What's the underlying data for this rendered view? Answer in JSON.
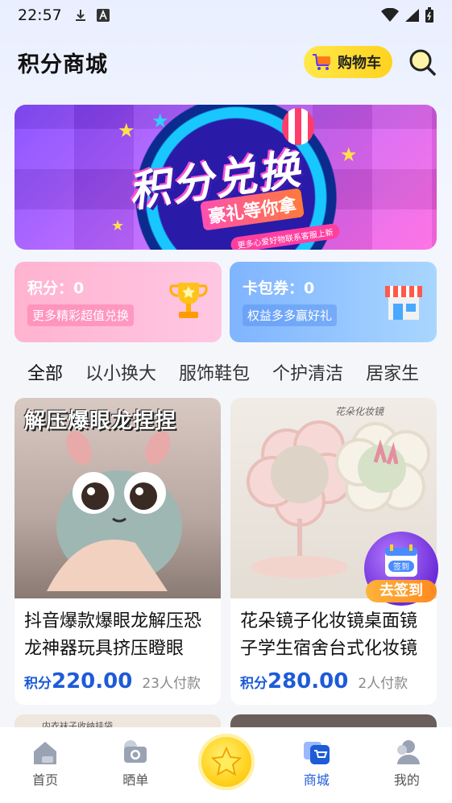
{
  "status_bar": {
    "time": "22:57"
  },
  "header": {
    "title": "积分商城",
    "cart_label": "购物车"
  },
  "banner": {
    "title": "积分兑换",
    "subtitle": "豪礼等你拿",
    "note": "更多心爱好物联系客服上新"
  },
  "cards": {
    "points": {
      "label": "积分：0",
      "sub": "更多精彩超值兑换"
    },
    "coupons": {
      "label": "卡包券：0",
      "sub": "权益多多赢好礼"
    }
  },
  "tabs": [
    {
      "label": "全部",
      "active": true
    },
    {
      "label": "以小换大"
    },
    {
      "label": "服饰鞋包"
    },
    {
      "label": "个护清洁"
    },
    {
      "label": "居家生"
    }
  ],
  "products": [
    {
      "image_caption": "解压爆眼龙捏捏",
      "name": "抖音爆款爆眼龙解压恐龙神器玩具挤压瞪眼",
      "price_label": "积分",
      "price": "220.00",
      "paid": "23人付款"
    },
    {
      "image_caption": "花朵化妆镜",
      "name": "花朵镜子化妆镜桌面镜子学生宿舍台式化妆镜",
      "price_label": "积分",
      "price": "280.00",
      "paid": "2人付款"
    }
  ],
  "peek": {
    "text": "内衣袜子收纳挂袋"
  },
  "checkin": {
    "label": "去签到",
    "badge": "签到"
  },
  "bottom_nav": [
    {
      "label": "首页"
    },
    {
      "label": "晒单"
    },
    {
      "label": "商城",
      "active": true
    },
    {
      "label": "我的"
    }
  ],
  "colors": {
    "accent": "#1d5bd8",
    "cart_bg": "#ffd21f",
    "points_card": "#ffb3cf",
    "coupon_card": "#7fb4ff"
  }
}
